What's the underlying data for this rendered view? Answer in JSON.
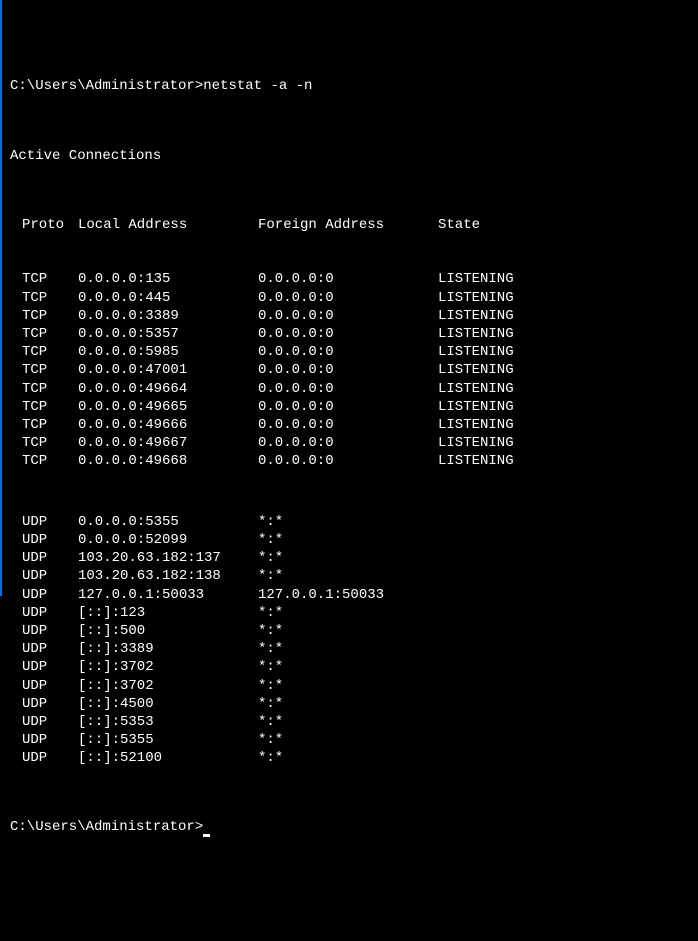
{
  "prompt1_path": "C:\\Users\\Administrator>",
  "prompt1_command": "netstat -a -n",
  "section_title": "Active Connections",
  "headers": {
    "proto": "Proto",
    "local": "Local Address",
    "foreign": "Foreign Address",
    "state": "State"
  },
  "rows_tcp": [
    {
      "proto": "TCP",
      "local": "0.0.0.0:135",
      "foreign": "0.0.0.0:0",
      "state": "LISTENING"
    },
    {
      "proto": "TCP",
      "local": "0.0.0.0:445",
      "foreign": "0.0.0.0:0",
      "state": "LISTENING"
    },
    {
      "proto": "TCP",
      "local": "0.0.0.0:3389",
      "foreign": "0.0.0.0:0",
      "state": "LISTENING"
    },
    {
      "proto": "TCP",
      "local": "0.0.0.0:5357",
      "foreign": "0.0.0.0:0",
      "state": "LISTENING"
    },
    {
      "proto": "TCP",
      "local": "0.0.0.0:5985",
      "foreign": "0.0.0.0:0",
      "state": "LISTENING"
    },
    {
      "proto": "TCP",
      "local": "0.0.0.0:47001",
      "foreign": "0.0.0.0:0",
      "state": "LISTENING"
    },
    {
      "proto": "TCP",
      "local": "0.0.0.0:49664",
      "foreign": "0.0.0.0:0",
      "state": "LISTENING"
    },
    {
      "proto": "TCP",
      "local": "0.0.0.0:49665",
      "foreign": "0.0.0.0:0",
      "state": "LISTENING"
    },
    {
      "proto": "TCP",
      "local": "0.0.0.0:49666",
      "foreign": "0.0.0.0:0",
      "state": "LISTENING"
    },
    {
      "proto": "TCP",
      "local": "0.0.0.0:49667",
      "foreign": "0.0.0.0:0",
      "state": "LISTENING"
    },
    {
      "proto": "TCP",
      "local": "0.0.0.0:49668",
      "foreign": "0.0.0.0:0",
      "state": "LISTENING"
    }
  ],
  "rows_udp": [
    {
      "proto": "UDP",
      "local": "0.0.0.0:5355",
      "foreign": "*:*",
      "state": ""
    },
    {
      "proto": "UDP",
      "local": "0.0.0.0:52099",
      "foreign": "*:*",
      "state": ""
    },
    {
      "proto": "UDP",
      "local": "103.20.63.182:137",
      "foreign": "*:*",
      "state": ""
    },
    {
      "proto": "UDP",
      "local": "103.20.63.182:138",
      "foreign": "*:*",
      "state": ""
    },
    {
      "proto": "UDP",
      "local": "127.0.0.1:50033",
      "foreign": "127.0.0.1:50033",
      "state": ""
    },
    {
      "proto": "UDP",
      "local": "[::]:123",
      "foreign": "*:*",
      "state": ""
    },
    {
      "proto": "UDP",
      "local": "[::]:500",
      "foreign": "*:*",
      "state": ""
    },
    {
      "proto": "UDP",
      "local": "[::]:3389",
      "foreign": "*:*",
      "state": ""
    },
    {
      "proto": "UDP",
      "local": "[::]:3702",
      "foreign": "*:*",
      "state": ""
    },
    {
      "proto": "UDP",
      "local": "[::]:3702",
      "foreign": "*:*",
      "state": ""
    },
    {
      "proto": "UDP",
      "local": "[::]:4500",
      "foreign": "*:*",
      "state": ""
    },
    {
      "proto": "UDP",
      "local": "[::]:5353",
      "foreign": "*:*",
      "state": ""
    },
    {
      "proto": "UDP",
      "local": "[::]:5355",
      "foreign": "*:*",
      "state": ""
    },
    {
      "proto": "UDP",
      "local": "[::]:52100",
      "foreign": "*:*",
      "state": ""
    }
  ],
  "prompt2_path": "C:\\Users\\Administrator>"
}
